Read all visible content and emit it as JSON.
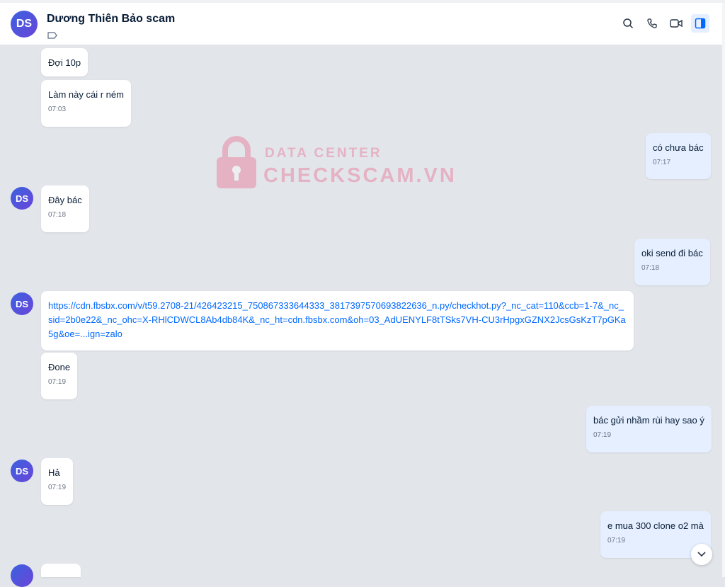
{
  "header": {
    "avatar_initials": "DS",
    "contact_name": "Dương Thiên Bảo scam",
    "icons": [
      "search-icon",
      "phone-icon",
      "video-call-icon",
      "side-panel-icon"
    ]
  },
  "watermark": {
    "line1": "DATA CENTER",
    "line2": "CHECKSCAM.VN"
  },
  "avatar_initials": "DS",
  "messages": [
    {
      "id": "m1",
      "text": "Đợi 10p"
    },
    {
      "id": "m2",
      "text": "Làm này cái r ném",
      "time": "07:03"
    },
    {
      "id": "m3",
      "text": "có chưa bác",
      "time": "07:17"
    },
    {
      "id": "m4",
      "text": "Đây bác",
      "time": "07:18"
    },
    {
      "id": "m5",
      "text": "oki send đi bác",
      "time": "07:18"
    },
    {
      "id": "m6",
      "text": "https://cdn.fbsbx.com/v/t59.2708-21/426423215_750867333644333_3817397570693822636_n.py/checkhot.py?_nc_cat=110&ccb=1-7&_nc_sid=2b0e22&_nc_ohc=X-RHlCDWCL8Ab4db84K&_nc_ht=cdn.fbsbx.com&oh=03_AdUENYLF8tTSks7VH-CU3rHpgxGZNX2JcsGsKzT7pGKa5g&oe=...ign=zalo"
    },
    {
      "id": "m7",
      "text": "Đone",
      "time": "07:19"
    },
    {
      "id": "m8",
      "text": "bác gửi nhầm rùi hay sao ý",
      "time": "07:19"
    },
    {
      "id": "m9",
      "text": "Hả",
      "time": "07:19"
    },
    {
      "id": "m10",
      "text": "e mua 300 clone o2 mà",
      "time": "07:19"
    }
  ],
  "colors": {
    "header_bg": "#ffffff",
    "chat_bg": "#e2e5ea",
    "incoming_bubble": "#ffffff",
    "outgoing_bubble": "#e5efff",
    "link": "#0068ff",
    "avatar": "#4a55dd",
    "watermark": "#e98aa4"
  }
}
